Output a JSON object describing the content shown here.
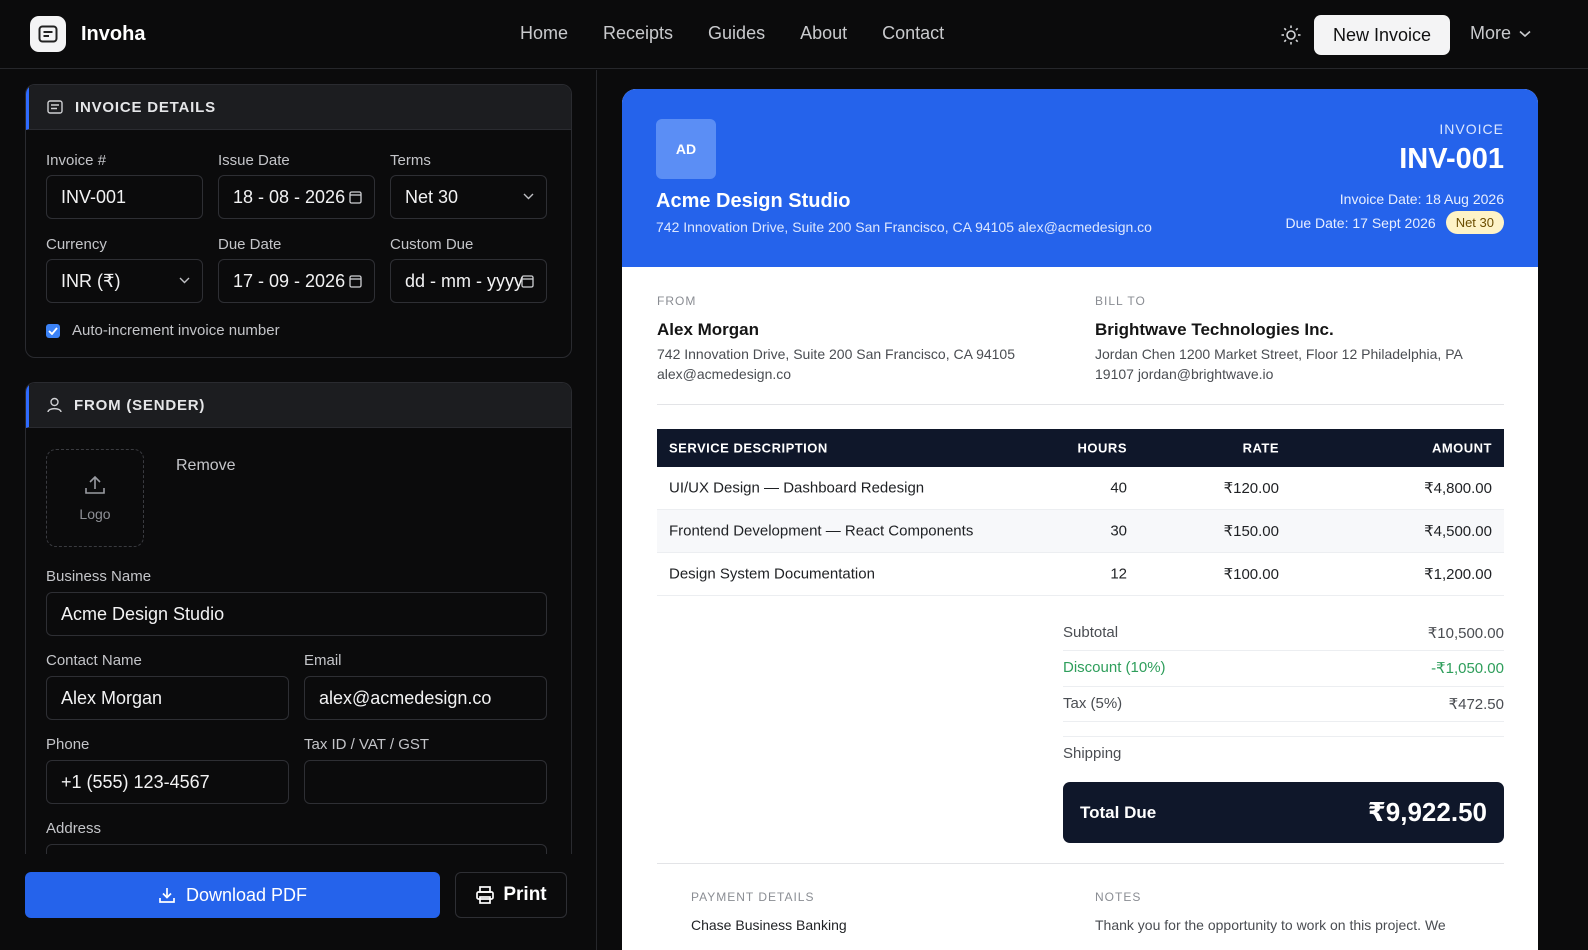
{
  "brand": {
    "name": "Invoha",
    "logo_icon": "invoice-doc-icon"
  },
  "nav": {
    "items": [
      "Home",
      "Receipts",
      "Guides",
      "About",
      "Contact"
    ]
  },
  "header_actions": {
    "theme_icon": "sun-icon",
    "new_invoice": "New Invoice",
    "more": "More"
  },
  "invoice_details": {
    "title": "INVOICE DETAILS",
    "invoice_no_label": "Invoice #",
    "invoice_no": "INV-001",
    "issue_date_label": "Issue Date",
    "issue_date": "18 - 08 - 2026",
    "terms_label": "Terms",
    "terms": "Net 30",
    "currency_label": "Currency",
    "currency": "INR (₹)",
    "due_date_label": "Due Date",
    "due_date": "17 - 09 - 2026",
    "custom_due_label": "Custom Due",
    "custom_due_placeholder": "dd - mm - yyyy",
    "auto_increment_label": "Auto-increment invoice number",
    "auto_increment": true
  },
  "sender": {
    "title": "FROM (SENDER)",
    "logo_label": "Logo",
    "remove_label": "Remove",
    "business_name_label": "Business Name",
    "business_name": "Acme Design Studio",
    "contact_name_label": "Contact Name",
    "contact_name": "Alex Morgan",
    "email_label": "Email",
    "email": "alex@acmedesign.co",
    "phone_label": "Phone",
    "phone": "+1 (555) 123-4567",
    "tax_label": "Tax ID / VAT / GST",
    "tax": "",
    "address_label": "Address"
  },
  "actions": {
    "download": "Download PDF",
    "print": "Print"
  },
  "preview": {
    "avatar": "AD",
    "business_name": "Acme Design Studio",
    "business_address": "742 Innovation Drive, Suite 200 San Francisco, CA 94105 alex@acmedesign.co",
    "invoice_word": "INVOICE",
    "invoice_number": "INV-001",
    "invoice_date": "Invoice Date: 18 Aug 2026",
    "due_date": "Due Date: 17 Sept 2026",
    "terms_badge": "Net 30",
    "from_label": "FROM",
    "from_name": "Alex Morgan",
    "from_address_1": "742 Innovation Drive, Suite 200 San Francisco, CA 94105",
    "from_address_2": "alex@acmedesign.co",
    "bill_to_label": "BILL TO",
    "bill_to_name": "Brightwave Technologies Inc.",
    "bill_to_address_1": "Jordan Chen 1200 Market Street, Floor 12 Philadelphia, PA",
    "bill_to_address_2": "19107 jordan@brightwave.io",
    "table_headers": {
      "desc": "SERVICE DESCRIPTION",
      "hours": "HOURS",
      "rate": "RATE",
      "amount": "AMOUNT"
    },
    "items": [
      {
        "desc": "UI/UX Design — Dashboard Redesign",
        "hours": "40",
        "rate": "₹120.00",
        "amount": "₹4,800.00"
      },
      {
        "desc": "Frontend Development — React Components",
        "hours": "30",
        "rate": "₹150.00",
        "amount": "₹4,500.00"
      },
      {
        "desc": "Design System Documentation",
        "hours": "12",
        "rate": "₹100.00",
        "amount": "₹1,200.00"
      }
    ],
    "subtotal_label": "Subtotal",
    "subtotal": "₹10,500.00",
    "discount_label": "Discount (10%)",
    "discount": "-₹1,050.00",
    "tax_label": "Tax (5%)",
    "tax": "₹472.50",
    "shipping_label": "Shipping",
    "total_label": "Total Due",
    "total": "₹9,922.50",
    "payment_details_label": "PAYMENT DETAILS",
    "payment_bank": "Chase Business Banking",
    "notes_label": "NOTES",
    "notes_text": "Thank you for the opportunity to work on this project. We"
  },
  "colors": {
    "accent": "#2563eb",
    "navy": "#0f172a",
    "discount": "#2e9e5b",
    "badge": "#fef3c7"
  }
}
